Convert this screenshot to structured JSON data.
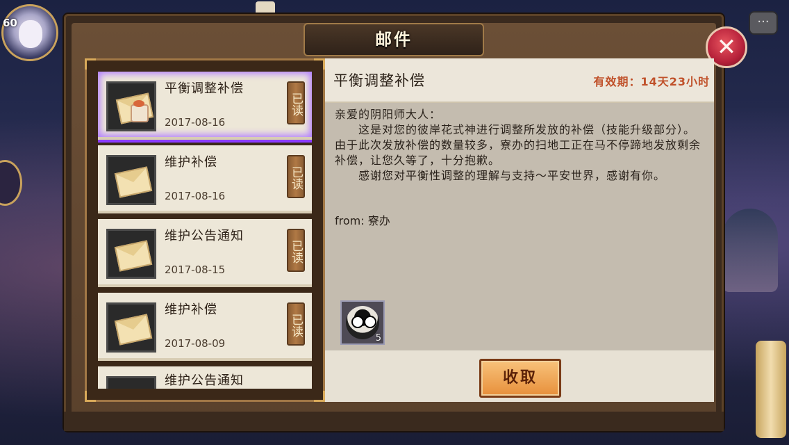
{
  "hud": {
    "level": "60"
  },
  "dialog": {
    "title": "邮件"
  },
  "mails": [
    {
      "title": "平衡调整补偿",
      "date": "2017-08-16",
      "status": "已读",
      "icon": "envelope-with-gift-icon",
      "selected": true
    },
    {
      "title": "维护补偿",
      "date": "2017-08-16",
      "status": "已读",
      "icon": "envelope-icon",
      "selected": false
    },
    {
      "title": "维护公告通知",
      "date": "2017-08-15",
      "status": "已读",
      "icon": "envelope-icon",
      "selected": false
    },
    {
      "title": "维护补偿",
      "date": "2017-08-09",
      "status": "已读",
      "icon": "envelope-icon",
      "selected": false
    },
    {
      "title": "维护公告通知",
      "date": "",
      "status": "",
      "icon": "envelope-icon",
      "selected": false
    }
  ],
  "detail": {
    "title": "平衡调整补偿",
    "expiry": "有效期：14天23小时",
    "body": "亲爱的阴阳师大人：\n　　这是对您的彼岸花式神进行调整所发放的补偿（技能升级部分）。由于此次发放补偿的数量较多，寮办的扫地工正在马不停蹄地发放剩余补偿，让您久等了，十分抱歉。\n　　感谢您对平衡性调整的理解与支持～平安世界，感谢有你。",
    "from": "from: 寮办",
    "reward": {
      "icon": "daruma-icon",
      "count": "5"
    },
    "claim_label": "收取"
  },
  "colors": {
    "selected_outline": "#8c3cff",
    "expiry": "#c0512a",
    "claim_button": "#e78f3b"
  }
}
